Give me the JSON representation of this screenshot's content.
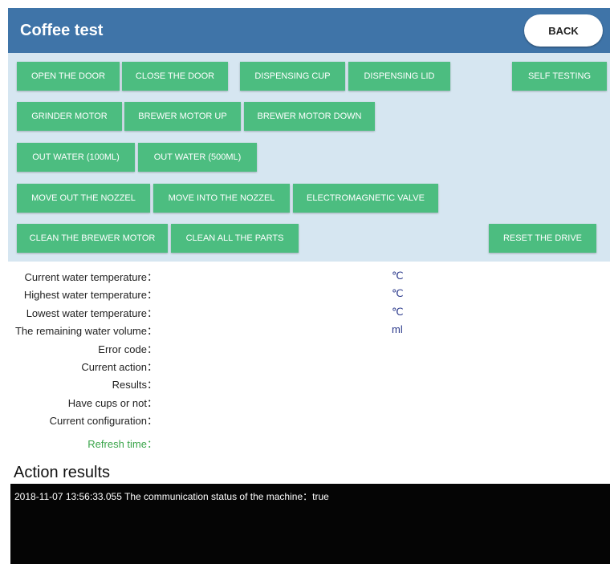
{
  "header": {
    "title": "Coffee test",
    "back_label": "BACK"
  },
  "buttons": {
    "open_door": "OPEN THE DOOR",
    "close_door": "CLOSE THE DOOR",
    "dispensing_cup": "DISPENSING CUP",
    "dispensing_lid": "DISPENSING LID",
    "self_testing": "SELF TESTING",
    "grinder_motor": "GRINDER MOTOR",
    "brewer_motor_up": "BREWER MOTOR UP",
    "brewer_motor_down": "BREWER MOTOR DOWN",
    "out_water_100": "OUT WATER (100ML)",
    "out_water_500": "OUT WATER (500ML)",
    "move_out_nozzel": "MOVE OUT THE NOZZEL",
    "move_into_nozzel": "MOVE INTO THE NOZZEL",
    "electromagnetic_valve": "ELECTROMAGNETIC VALVE",
    "clean_brewer_motor": "CLEAN THE BREWER MOTOR",
    "clean_all_parts": "CLEAN ALL THE PARTS",
    "reset_drive": "RESET THE DRIVE"
  },
  "status": {
    "current_water_temp": "Current water temperature：",
    "highest_water_temp": "Highest water temperature：",
    "lowest_water_temp": "Lowest water temperature：",
    "remaining_water": "The remaining water volume：",
    "error_code": "Error code：",
    "current_action": "Current action：",
    "results": "Results：",
    "have_cups": "Have cups or not：",
    "current_config": "Current configuration：",
    "refresh_time": "Refresh time：",
    "unit_celsius": "℃",
    "unit_ml": "ml"
  },
  "action_results": {
    "title": "Action results",
    "log": "2018-11-07 13:56:33.055  The communication status of the machine：true"
  },
  "colors": {
    "header": "#3f74a8",
    "panel": "#d6e6f1",
    "button": "#4cbd80",
    "refresh": "#3aa54a",
    "unit": "#2c3a8c"
  }
}
